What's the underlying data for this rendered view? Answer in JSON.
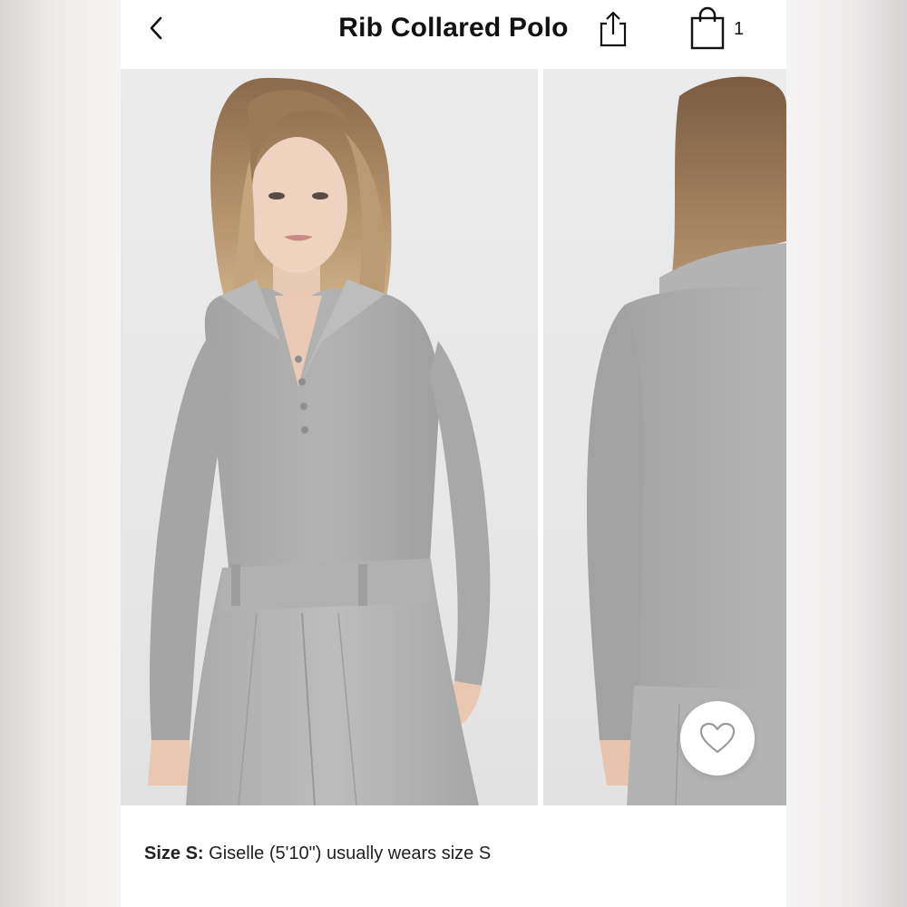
{
  "header": {
    "title": "Rib Collared Polo",
    "back_icon": "chevron-left-icon",
    "share_icon": "share-icon",
    "bag_icon": "shopping-bag-icon",
    "bag_count": "1"
  },
  "gallery": {
    "images": [
      {
        "view": "front",
        "description_icon": "product-photo-front"
      },
      {
        "view": "back",
        "description_icon": "product-photo-back"
      }
    ],
    "favorite_icon": "heart-icon"
  },
  "size_info": {
    "label": "Size S:",
    "text": " Giselle (5'10\") usually wears size S"
  },
  "colors": {
    "text": "#111111",
    "garment": "#a9a9a9",
    "background": "#e9e9e9"
  }
}
